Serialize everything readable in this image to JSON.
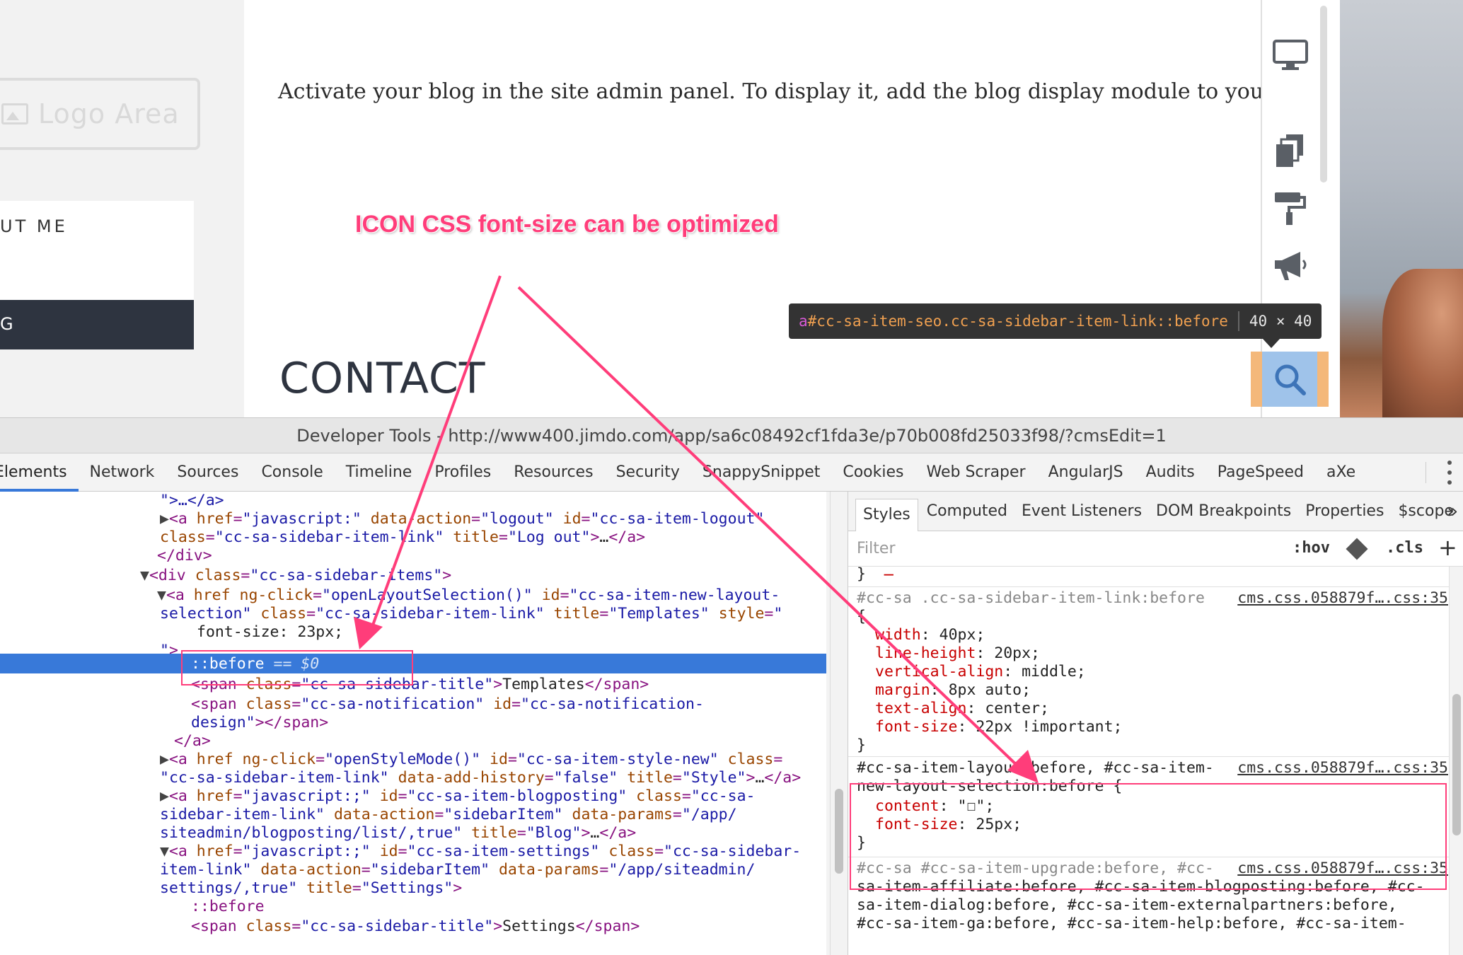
{
  "site": {
    "logo_text": "Logo Area",
    "nav_about": "UT ME",
    "nav_dark": "G",
    "body_text": "Activate your blog in the site admin panel. To display it, add the blog display module to your websi",
    "heading": "CONTACT"
  },
  "annotation": "ICON CSS font-size can be optimized",
  "tooltip": {
    "tag": "a",
    "id": "#cc-sa-item-seo",
    "cls": ".cc-sa-sidebar-item-link::before",
    "size": "40 × 40"
  },
  "devtools": {
    "title": "Developer Tools - http://www400.jimdo.com/app/sa6c08492cf1fda3e/p70b008fd25033f98/?cmsEdit=1",
    "tabs": [
      "Elements",
      "Network",
      "Sources",
      "Console",
      "Timeline",
      "Profiles",
      "Resources",
      "Security",
      "SnappySnippet",
      "Cookies",
      "Web Scraper",
      "AngularJS",
      "Audits",
      "PageSpeed",
      "aXe"
    ],
    "active_tab": "Elements",
    "styles_tabs": [
      "Styles",
      "Computed",
      "Event Listeners",
      "DOM Breakpoints",
      "Properties",
      "$scope"
    ],
    "filter_placeholder": "Filter",
    "hov": ":hov",
    "cls": ".cls",
    "selected_node": "::before == $0"
  },
  "dom_lines": [
    {
      "t": "\">…</a>"
    },
    {
      "t": "▶<a href=\"javascript:\" data-action=\"logout\" id=\"cc-sa-item-logout\""
    },
    {
      "t": "class=\"cc-sa-sidebar-item-link\" title=\"Log out\">…</a>"
    },
    {
      "t": "</div>"
    },
    {
      "t": "▼<div class=\"cc-sa-sidebar-items\">"
    },
    {
      "t": "▼<a href ng-click=\"openLayoutSelection()\" id=\"cc-sa-item-new-layout-"
    },
    {
      "t": "selection\" class=\"cc-sa-sidebar-item-link\" title=\"Templates\" style=\""
    },
    {
      "t": "font-size: 23px;"
    },
    {
      "t": "\">"
    },
    {
      "t": "<span class=\"cc-sa-sidebar-title\">Templates</span>"
    },
    {
      "t": "<span class=\"cc-sa-notification\" id=\"cc-sa-notification-"
    },
    {
      "t": "design\"></span>"
    },
    {
      "t": "</a>"
    },
    {
      "t": "▶<a href ng-click=\"openStyleMode()\" id=\"cc-sa-item-style-new\" class="
    },
    {
      "t": "\"cc-sa-sidebar-item-link\" data-add-history=\"false\" title=\"Style\">…</a>"
    },
    {
      "t": "▶<a href=\"javascript:;\" id=\"cc-sa-item-blogposting\" class=\"cc-sa-"
    },
    {
      "t": "sidebar-item-link\" data-action=\"sidebarItem\" data-params=\"/app/"
    },
    {
      "t": "siteadmin/blogposting/list/,true\" title=\"Blog\">…</a>"
    },
    {
      "t": "▼<a href=\"javascript:;\" id=\"cc-sa-item-settings\" class=\"cc-sa-sidebar-"
    },
    {
      "t": "item-link\" data-action=\"sidebarItem\" data-params=\"/app/siteadmin/"
    },
    {
      "t": "settings/,true\" title=\"Settings\">"
    },
    {
      "t": "::before"
    },
    {
      "t": "<span class=\"cc-sa-sidebar-title\">Settings</span>"
    }
  ],
  "css_rules": [
    {
      "selector_dim": "#cc-sa",
      "selector": " .cc-sa-sidebar-item-link:before",
      "source": "cms.css.058879f….css:35",
      "props": [
        {
          "name": "width",
          "value": "40px;"
        },
        {
          "name": "line-height",
          "value": "20px;"
        },
        {
          "name": "vertical-align",
          "value": "middle;"
        },
        {
          "name": "margin",
          "value": "8px auto;"
        },
        {
          "name": "text-align",
          "value": "center;"
        },
        {
          "name": "font-size",
          "value": "22px !important;"
        }
      ]
    },
    {
      "selector_line1": "#cc-sa-item-layout:before, #cc-sa-item-",
      "selector_line2": "new-layout-selection:before {",
      "source": "cms.css.058879f….css:35",
      "props": [
        {
          "name": "content",
          "value": "\"☐\";"
        },
        {
          "name": "font-size",
          "value": "25px;"
        }
      ]
    },
    {
      "selector_dim": "#cc-sa",
      "selector_line1": " #cc-sa-item-upgrade:before, #cc-",
      "selector_line2": "sa-item-affiliate:before, #cc-sa-item-blogposting:before, #cc-",
      "selector_line3": "sa-item-dialog:before, #cc-sa-item-externalpartners:before,",
      "selector_line4": "#cc-sa-item-ga:before, #cc-sa-item-help:before, #cc-sa-item-",
      "source": "cms.css.058879f….css:35"
    }
  ],
  "colors": {
    "annotation": "#ff3d7a",
    "selection": "#3879d9",
    "tag": "#881280",
    "attr": "#994500",
    "value": "#1a1aa6"
  },
  "icons": [
    "monitor-icon",
    "pages-icon",
    "paint-roller-icon",
    "megaphone-icon",
    "search-icon"
  ]
}
